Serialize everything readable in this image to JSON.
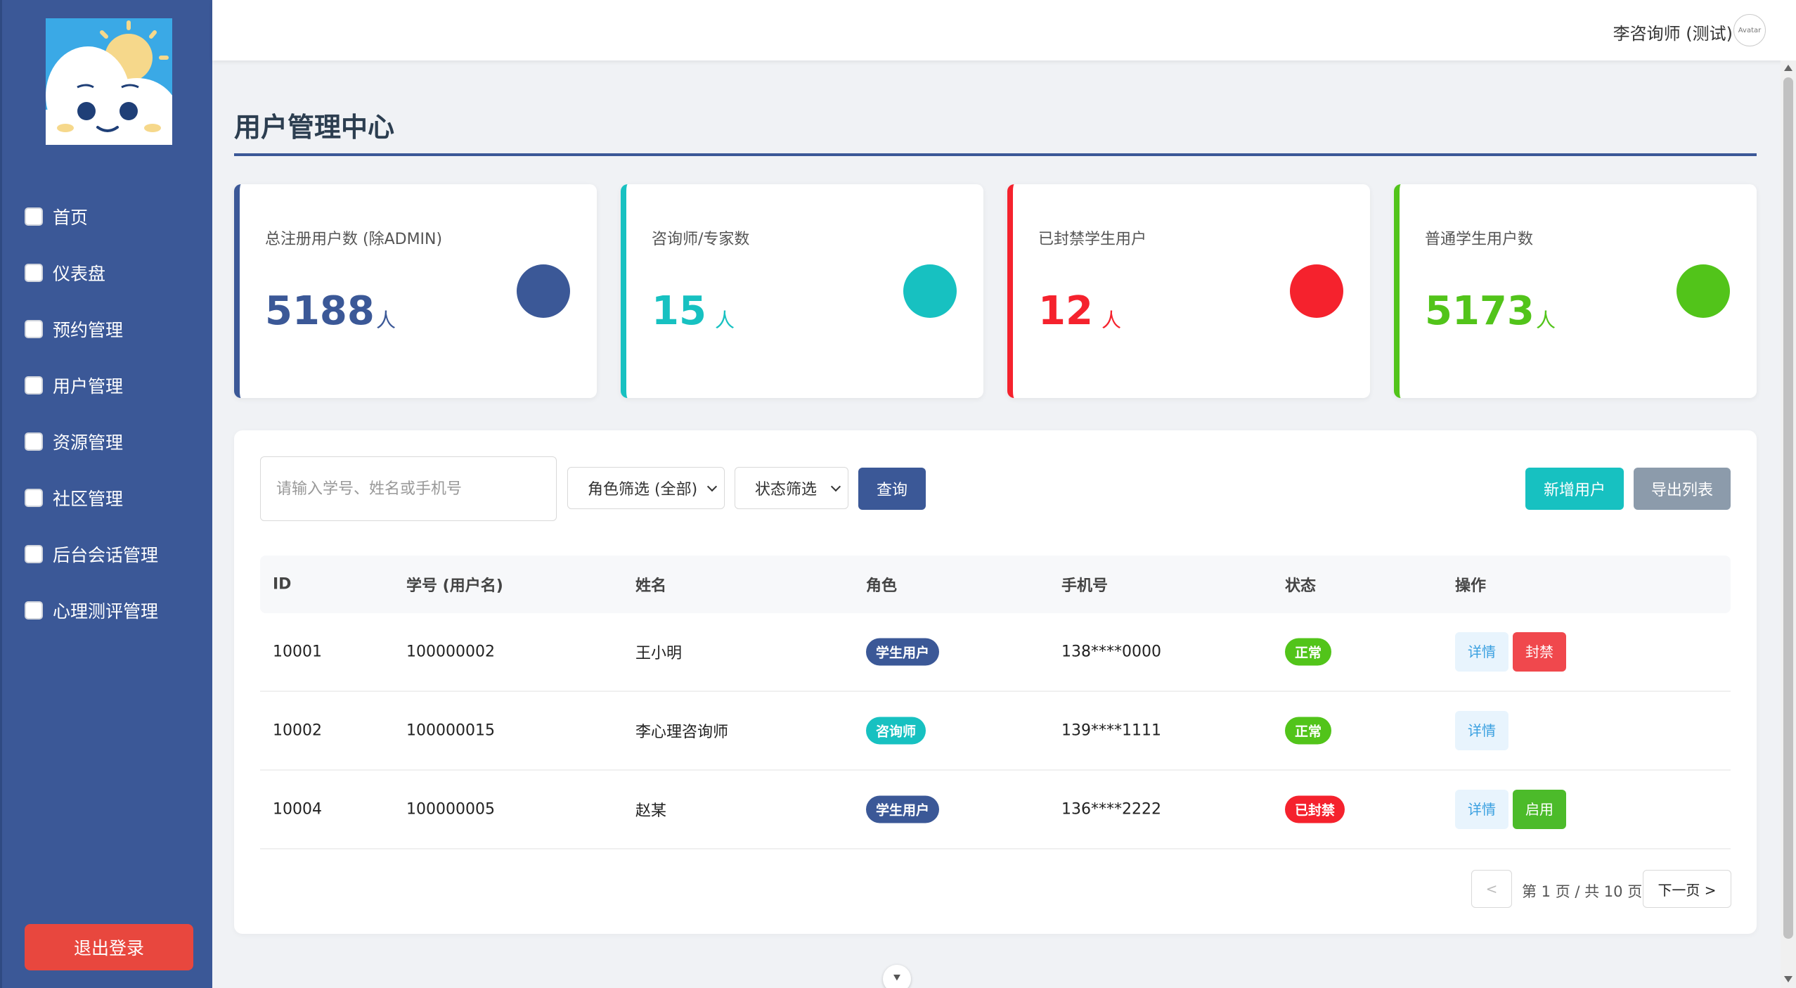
{
  "topbar": {
    "user_name": "李咨询师 (测试)",
    "avatar_alt": "Avatar"
  },
  "sidebar": {
    "items": [
      {
        "label": "首页"
      },
      {
        "label": "仪表盘"
      },
      {
        "label": "预约管理"
      },
      {
        "label": "用户管理"
      },
      {
        "label": "资源管理"
      },
      {
        "label": "社区管理"
      },
      {
        "label": "后台会话管理"
      },
      {
        "label": "心理测评管理"
      }
    ],
    "logout_label": "退出登录"
  },
  "page": {
    "title": "用户管理中心"
  },
  "stats": [
    {
      "label": "总注册用户数 (除ADMIN)",
      "value": "5188",
      "unit": "人",
      "color": "#3b5897"
    },
    {
      "label": "咨询师/专家数",
      "value": "15",
      "unit": "人",
      "color": "#17c1c1"
    },
    {
      "label": "已封禁学生用户",
      "value": "12",
      "unit": "人",
      "color": "#f5222d"
    },
    {
      "label": "普通学生用户数",
      "value": "5173",
      "unit": "人",
      "color": "#52c41a"
    }
  ],
  "filters": {
    "search_placeholder": "请输入学号、姓名或手机号",
    "role_select": "角色筛选 (全部)",
    "status_select": "状态筛选",
    "query_label": "查询",
    "add_user_label": "新增用户",
    "export_label": "导出列表"
  },
  "table": {
    "headers": [
      "ID",
      "学号 (用户名)",
      "姓名",
      "角色",
      "手机号",
      "状态",
      "操作"
    ],
    "rows": [
      {
        "id": "10001",
        "username": "100000002",
        "name": "王小明",
        "role": "学生用户",
        "phone": "138****0000",
        "status": "正常",
        "actions": [
          "详情",
          "封禁"
        ]
      },
      {
        "id": "10002",
        "username": "100000015",
        "name": "李心理咨询师",
        "role": "咨询师",
        "phone": "139****1111",
        "status": "正常",
        "actions": [
          "详情"
        ]
      },
      {
        "id": "10004",
        "username": "100000005",
        "name": "赵某",
        "role": "学生用户",
        "phone": "136****2222",
        "status": "已封禁",
        "actions": [
          "详情",
          "启用"
        ]
      }
    ]
  },
  "pagination": {
    "prev_label": "<",
    "info": "第 1 页 / 共 10 页",
    "next_label": "下一页 >"
  },
  "colors": {
    "primary": "#3b5897",
    "teal": "#17c1c1",
    "red": "#f5222d",
    "green": "#52c41a",
    "export_gray": "#8c9bab"
  },
  "scroll_hint_icon": "chevron-down-icon"
}
